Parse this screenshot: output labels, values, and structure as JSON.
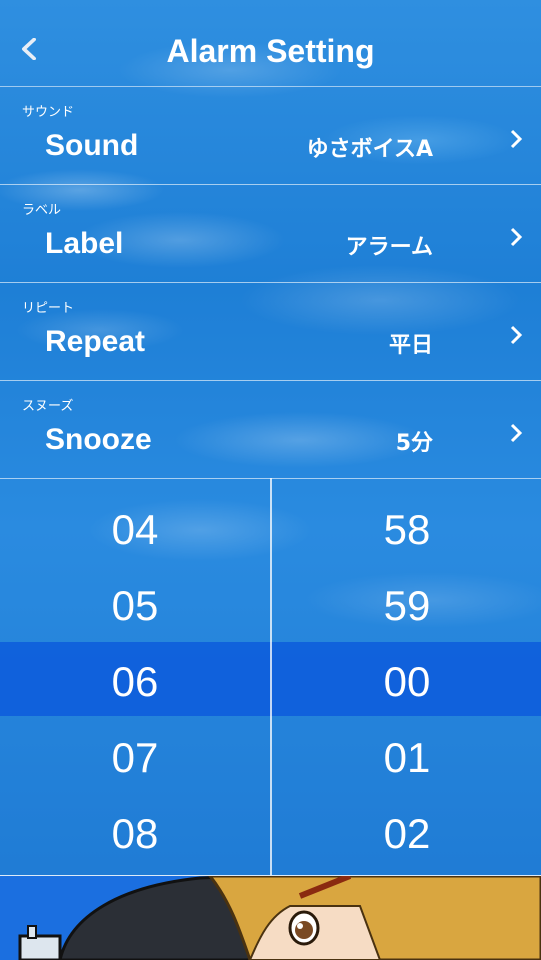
{
  "header": {
    "title": "Alarm Setting",
    "back_icon": "chevron-left-icon"
  },
  "rows": [
    {
      "kana": "サウンド",
      "label": "Sound",
      "value": "ゆさボイスA"
    },
    {
      "kana": "ラベル",
      "label": "Label",
      "value": "アラーム"
    },
    {
      "kana": "リピート",
      "label": "Repeat",
      "value": "平日"
    },
    {
      "kana": "スヌーズ",
      "label": "Snooze",
      "value": "5分"
    }
  ],
  "picker": {
    "hours": [
      "04",
      "05",
      "06",
      "07",
      "08"
    ],
    "minutes": [
      "58",
      "59",
      "00",
      "01",
      "02"
    ],
    "selected_hour": "06",
    "selected_minute": "00"
  },
  "colors": {
    "accent": "#1e7fd6",
    "selection": "#0a55dc"
  }
}
